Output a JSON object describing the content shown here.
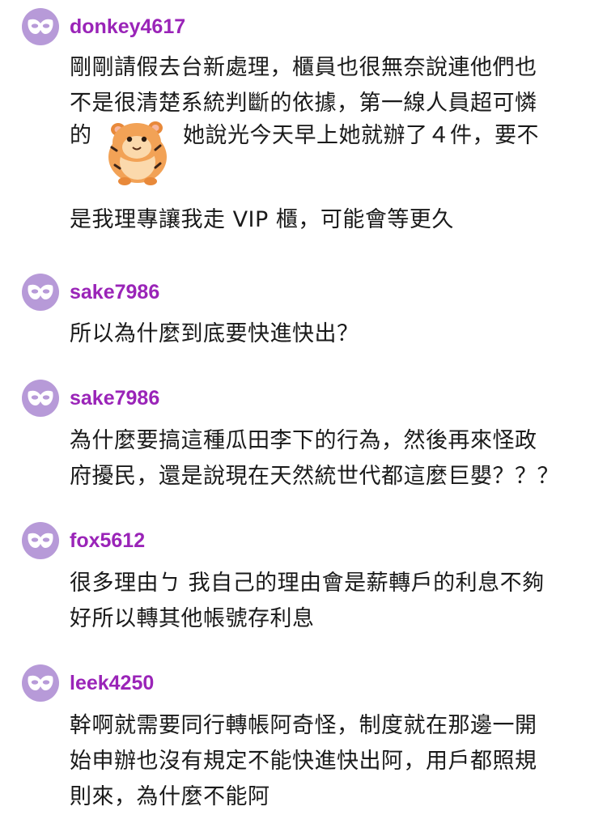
{
  "comments": [
    {
      "username": "donkey4617",
      "lines": [
        "剛剛請假去台新處理，櫃員也很無奈說連他們也",
        "不是很清楚系統判斷的依據，第一線人員超可憐"
      ],
      "sticker_line": {
        "pre": "的",
        "post": "她說光今天早上她就辦了４件，要不"
      },
      "sticker_icon": "hamster-sticker-icon",
      "last_line": "是我理專讓我走 VIP 櫃，可能會等更久"
    },
    {
      "username": "sake7986",
      "lines": [
        "所以為什麼到底要快進快出？"
      ]
    },
    {
      "username": "sake7986",
      "lines": [
        "為什麼要搞這種瓜田李下的行為，然後再來怪政",
        "府擾民，還是說現在天然統世代都這麼巨嬰？？？"
      ]
    },
    {
      "username": "fox5612",
      "lines": [
        "很多理由ㄅ 我自己的理由會是薪轉戶的利息不夠",
        "好所以轉其他帳號存利息"
      ]
    },
    {
      "username": "leek4250",
      "lines": [
        "幹啊就需要同行轉帳阿奇怪，制度就在那邊一開",
        "始申辦也沒有規定不能快進快出阿，用戶都照規",
        "則來，為什麼不能阿"
      ]
    }
  ],
  "colors": {
    "avatar_bg": "#b79ad8",
    "username": "#9a24b8",
    "text": "#1a1a1a"
  },
  "avatar_icon": "mask-icon"
}
